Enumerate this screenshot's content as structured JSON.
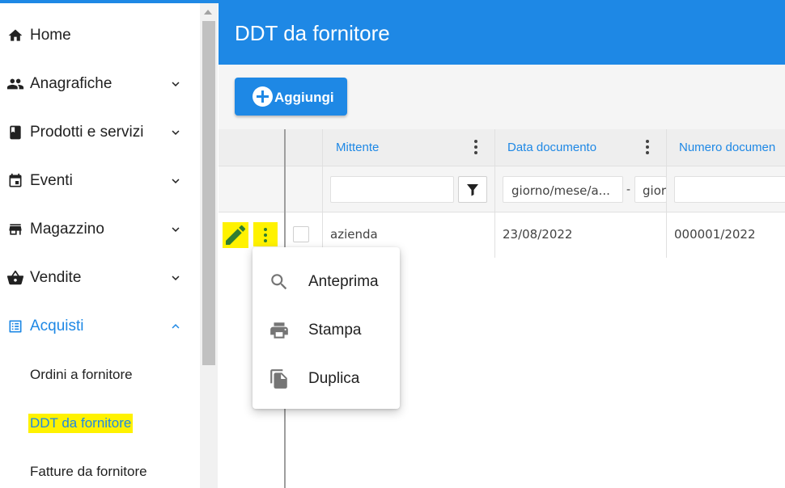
{
  "sidebar": {
    "items": [
      {
        "label": "Home",
        "icon": "home-icon",
        "expandable": false
      },
      {
        "label": "Anagrafiche",
        "icon": "people-icon",
        "expandable": true
      },
      {
        "label": "Prodotti e servizi",
        "icon": "book-icon",
        "expandable": true
      },
      {
        "label": "Eventi",
        "icon": "calendar-icon",
        "expandable": true
      },
      {
        "label": "Magazzino",
        "icon": "store-icon",
        "expandable": true
      },
      {
        "label": "Vendite",
        "icon": "basket-icon",
        "expandable": true
      },
      {
        "label": "Acquisti",
        "icon": "list-alt-icon",
        "expandable": true,
        "expanded": true
      }
    ],
    "subitems": [
      {
        "label": "Ordini a fornitore"
      },
      {
        "label": "DDT da fornitore",
        "highlighted": true
      },
      {
        "label": "Fatture da fornitore"
      }
    ]
  },
  "header": {
    "title": "DDT da fornitore"
  },
  "toolbar": {
    "add_label": "Aggiungi"
  },
  "grid": {
    "columns": [
      {
        "label": "Mittente"
      },
      {
        "label": "Data documento"
      },
      {
        "label": "Numero documen"
      }
    ],
    "filters": {
      "date_from_placeholder": "giorno/mese/a...",
      "date_separator": "-",
      "date_to_placeholder": "gior"
    },
    "rows": [
      {
        "mittente": "azienda",
        "data": "23/08/2022",
        "numero": "000001/2022"
      }
    ]
  },
  "context_menu": {
    "items": [
      {
        "label": "Anteprima",
        "icon": "search-icon"
      },
      {
        "label": "Stampa",
        "icon": "print-icon"
      },
      {
        "label": "Duplica",
        "icon": "copy-icon"
      }
    ]
  },
  "colors": {
    "accent": "#1e88e5",
    "highlight": "#fff200"
  }
}
